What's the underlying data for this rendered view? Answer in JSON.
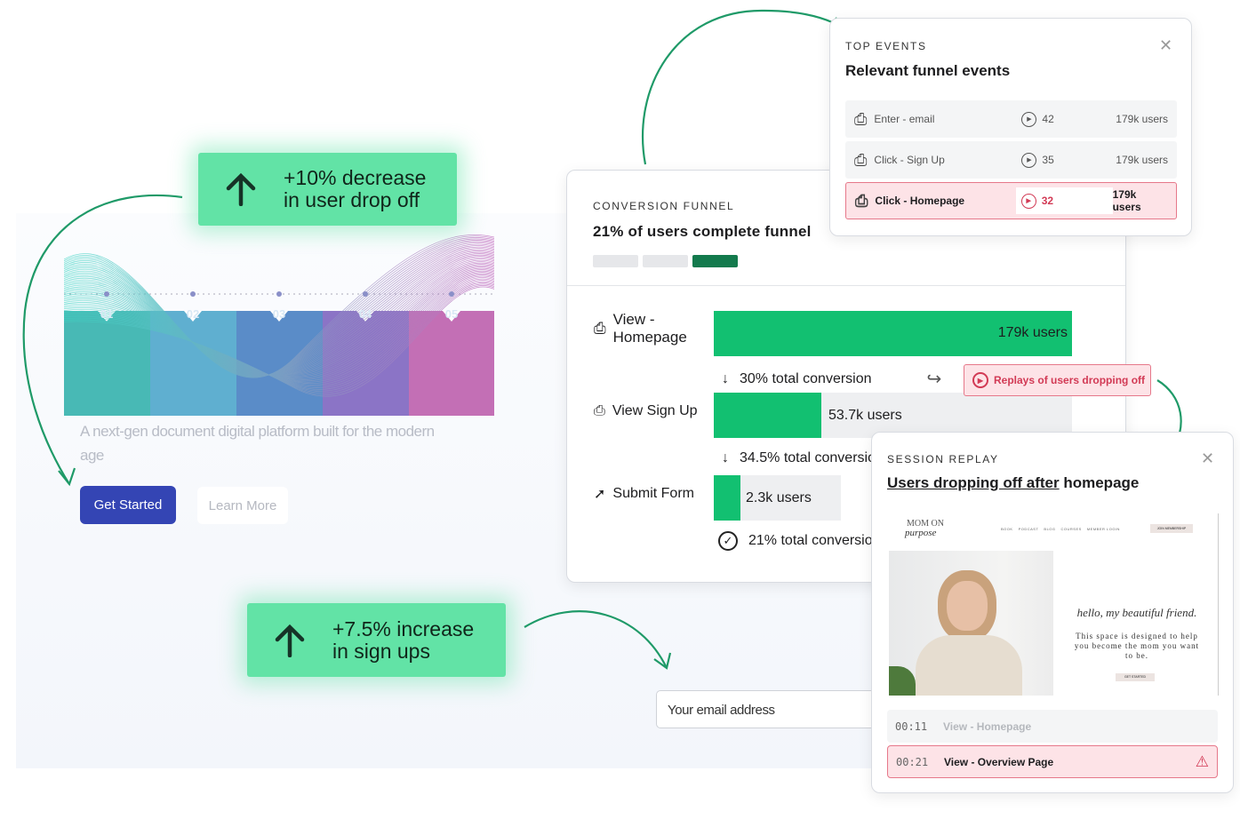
{
  "hero": {
    "chart_steps": [
      "01",
      "02",
      "03",
      "04",
      "05"
    ],
    "tagline": "A next-gen document digital platform built for the modern age",
    "get_started": "Get Started",
    "learn_more": "Learn More",
    "email_placeholder": "Your email address"
  },
  "callouts": [
    {
      "line1": "+10% decrease",
      "line2": "in user drop off",
      "icon": "arrow-up-icon"
    },
    {
      "line1": "+7.5% increase",
      "line2": "in sign ups",
      "icon": "arrow-up-icon"
    }
  ],
  "funnel": {
    "eyebrow": "CONVERSION FUNNEL",
    "title": "21% of users complete funnel",
    "steps": [
      {
        "label": "View - Homepage",
        "value": "179k users",
        "fill_percent": 100
      },
      {
        "label": "View Sign Up",
        "value": "53.7k users",
        "fill_percent": 30
      },
      {
        "label": "Submit Form",
        "value": "2.3k users",
        "fill_percent": 7.5
      }
    ],
    "conversions": [
      "30% total conversion",
      "34.5% total conversion",
      "21% total conversion"
    ],
    "replays_button": "Replays of users dropping off",
    "colors": {
      "bar": "#12c071",
      "alert": "#d23a55"
    }
  },
  "top_events": {
    "eyebrow": "TOP EVENTS",
    "title": "Relevant funnel events",
    "rows": [
      {
        "name": "Enter - email",
        "replays": "42",
        "users": "179k users"
      },
      {
        "name": "Click - Sign Up",
        "replays": "35",
        "users": "179k users"
      },
      {
        "name": "Click - Homepage",
        "replays": "32",
        "users": "179k users",
        "highlighted": true
      }
    ]
  },
  "session_replay": {
    "eyebrow": "SESSION REPLAY",
    "title_link": "Users dropping off after",
    "title_rest": " homepage",
    "preview": {
      "brand1": "MOM ON",
      "brand2": "purpose",
      "nav": [
        "BOOK",
        "PODCAST",
        "BLOG",
        "COURSES",
        "MEMBER LOGIN"
      ],
      "cta": "JOIN MEMBERSHIP",
      "script": "hello, my beautiful friend.",
      "body": "This space is designed to help you become the mom you want to be.",
      "button": "GET STARTED"
    },
    "timeline": [
      {
        "time": "00:11",
        "event": "View - Homepage"
      },
      {
        "time": "00:21",
        "event": "View - Overview Page",
        "alert": true
      }
    ]
  }
}
